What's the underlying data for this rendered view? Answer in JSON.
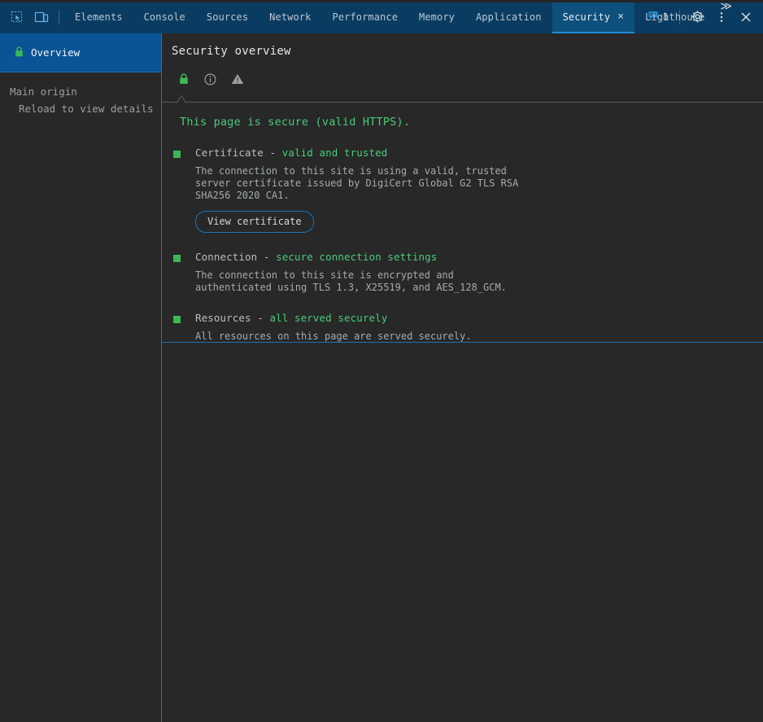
{
  "toolbar": {
    "inspect_icon": "inspect-cursor-icon",
    "device_toolbar_icon": "device-toolbar-icon",
    "tabs": [
      {
        "label": "Elements",
        "active": false,
        "closable": false
      },
      {
        "label": "Console",
        "active": false,
        "closable": false
      },
      {
        "label": "Sources",
        "active": false,
        "closable": false
      },
      {
        "label": "Network",
        "active": false,
        "closable": false
      },
      {
        "label": "Performance",
        "active": false,
        "closable": false
      },
      {
        "label": "Memory",
        "active": false,
        "closable": false
      },
      {
        "label": "Application",
        "active": false,
        "closable": false
      },
      {
        "label": "Security",
        "active": true,
        "closable": true
      },
      {
        "label": "Lighthouse",
        "active": false,
        "closable": false
      }
    ],
    "tab_close_glyph": "×",
    "more_tabs_glyph": "≫",
    "issues_count": "1",
    "issues_icon": "issues-message-icon",
    "settings_icon": "gear-icon",
    "more_options_icon": "more-vertical-icon",
    "close_icon": "close-icon",
    "active_tab_accent": "#1a8cd8",
    "bar_background": "#0a3c61"
  },
  "sidebar": {
    "overview": {
      "label": "Overview",
      "icon": "lock-icon",
      "selected": true
    },
    "origin_group": {
      "title": "Main origin",
      "item": "Reload to view details"
    },
    "selected_background": "#0a5394"
  },
  "main": {
    "title": "Security overview",
    "summary_icons": [
      {
        "name": "lock-icon",
        "state": "active",
        "color": "#3ab859"
      },
      {
        "name": "info-icon",
        "state": "inactive",
        "color": "#9aa0a6"
      },
      {
        "name": "warning-icon",
        "state": "inactive",
        "color": "#9aa0a6"
      }
    ],
    "headline": "This page is secure (valid HTTPS).",
    "headline_color": "#4cc97c",
    "sections": [
      {
        "title_label": "Certificate - ",
        "title_value": "valid and trusted",
        "description": "The connection to this site is using a valid, trusted server certificate issued by DigiCert Global G2 TLS RSA SHA256 2020 CA1.",
        "button": "View certificate",
        "bullet_color": "#3ab859"
      },
      {
        "title_label": "Connection - ",
        "title_value": "secure connection settings",
        "description": "The connection to this site is encrypted and authenticated using TLS 1.3, X25519, and AES_128_GCM.",
        "button": null,
        "bullet_color": "#3ab859"
      },
      {
        "title_label": "Resources - ",
        "title_value": "all served securely",
        "description": "All resources on this page are served securely.",
        "button": null,
        "bullet_color": "#3ab859"
      }
    ]
  }
}
